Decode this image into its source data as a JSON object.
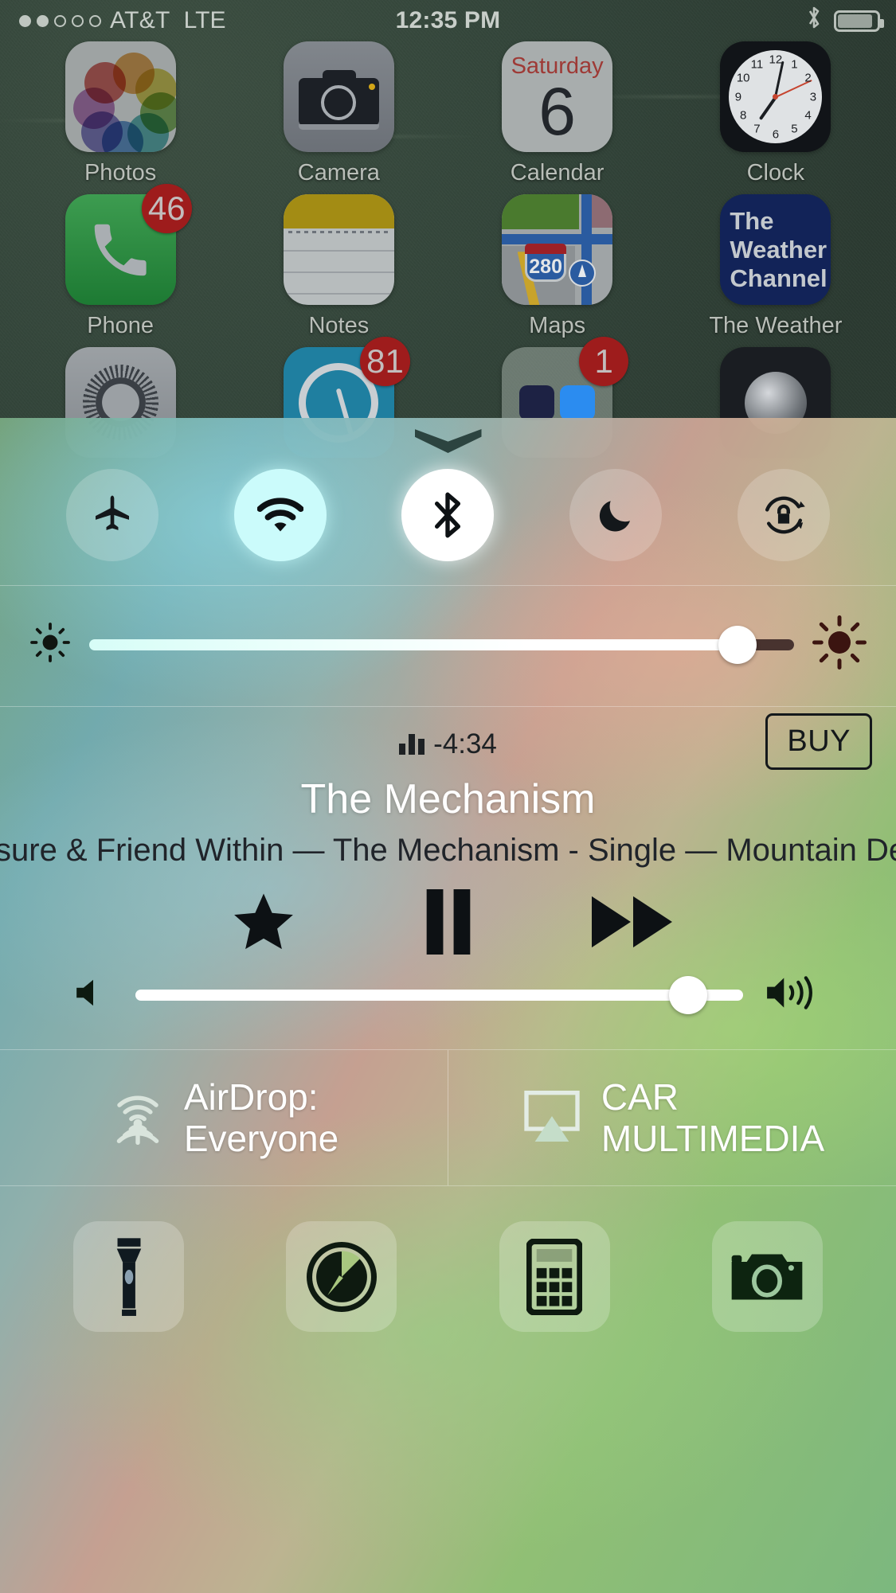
{
  "statusbar": {
    "signal_dots_filled": 2,
    "signal_dots_total": 5,
    "carrier": "AT&T",
    "network": "LTE",
    "time": "12:35 PM",
    "bluetooth_icon": "bluetooth-icon",
    "battery_icon": "battery-icon"
  },
  "homescreen": {
    "rows": [
      [
        {
          "label": "Photos",
          "icon": "photos-icon",
          "badge": null
        },
        {
          "label": "Camera",
          "icon": "camera-icon",
          "badge": null
        },
        {
          "label": "Calendar",
          "icon": "calendar-icon",
          "badge": null,
          "day": "Saturday",
          "date": "6"
        },
        {
          "label": "Clock",
          "icon": "clock-icon",
          "badge": null
        }
      ],
      [
        {
          "label": "Phone",
          "icon": "phone-icon",
          "badge": "46"
        },
        {
          "label": "Notes",
          "icon": "notes-icon",
          "badge": null
        },
        {
          "label": "Maps",
          "icon": "maps-icon",
          "badge": null,
          "route": "280"
        },
        {
          "label": "The Weather",
          "icon": "weather-channel-icon",
          "badge": null,
          "brand_line1": "The",
          "brand_line2": "Weather",
          "brand_line3": "Channel"
        }
      ],
      [
        {
          "label": "",
          "icon": "settings-icon",
          "badge": null
        },
        {
          "label": "",
          "icon": "podcasts-icon",
          "badge": "81"
        },
        {
          "label": "",
          "icon": "folder-icon",
          "badge": "1"
        },
        {
          "label": "",
          "icon": "camera-app-icon",
          "badge": null
        }
      ]
    ],
    "clock_numerals": [
      "12",
      "1",
      "2",
      "3",
      "4",
      "5",
      "6",
      "7",
      "8",
      "9",
      "10",
      "11"
    ]
  },
  "control_center": {
    "grabber": "grabber-handle",
    "toggles": [
      {
        "name": "airplane-mode-toggle",
        "icon": "airplane-icon",
        "state": "off"
      },
      {
        "name": "wifi-toggle",
        "icon": "wifi-icon",
        "state": "on"
      },
      {
        "name": "bluetooth-toggle",
        "icon": "bluetooth-icon",
        "state": "on"
      },
      {
        "name": "do-not-disturb-toggle",
        "icon": "moon-icon",
        "state": "off"
      },
      {
        "name": "rotation-lock-toggle",
        "icon": "rotation-lock-icon",
        "state": "off"
      }
    ],
    "brightness": {
      "label_low_icon": "brightness-low-icon",
      "label_high_icon": "brightness-high-icon",
      "value_percent": 92
    },
    "now_playing": {
      "remaining_time": "-4:34",
      "eq_icon": "equalizer-icon",
      "buy_label": "BUY",
      "track_title": "The Mechanism",
      "marquee_text": "sure & Friend Within — The Mechanism - Single — Mountain Dew (",
      "controls": [
        {
          "name": "favorite-button",
          "icon": "star-icon"
        },
        {
          "name": "play-pause-button",
          "icon": "pause-icon"
        },
        {
          "name": "next-track-button",
          "icon": "fast-forward-icon"
        }
      ],
      "volume": {
        "label_low_icon": "volume-low-icon",
        "label_high_icon": "volume-high-icon",
        "value_percent": 91
      }
    },
    "sharing": [
      {
        "name": "airdrop-button",
        "icon": "airdrop-icon",
        "line1": "AirDrop:",
        "line2": "Everyone"
      },
      {
        "name": "airplay-button",
        "icon": "airplay-icon",
        "line1": "CAR",
        "line2": "MULTIMEDIA"
      }
    ],
    "shortcuts": [
      {
        "name": "flashlight-button",
        "icon": "flashlight-icon"
      },
      {
        "name": "timer-button",
        "icon": "timer-icon"
      },
      {
        "name": "calculator-button",
        "icon": "calculator-icon"
      },
      {
        "name": "camera-button",
        "icon": "camera-icon"
      }
    ]
  },
  "colors": {
    "badge_red": "#9e1c1c",
    "wifi_on": "#cbfbfb",
    "bluetooth_on": "#ffffff",
    "weather_blue": "#122358",
    "phone_green": "#1d7a33"
  }
}
